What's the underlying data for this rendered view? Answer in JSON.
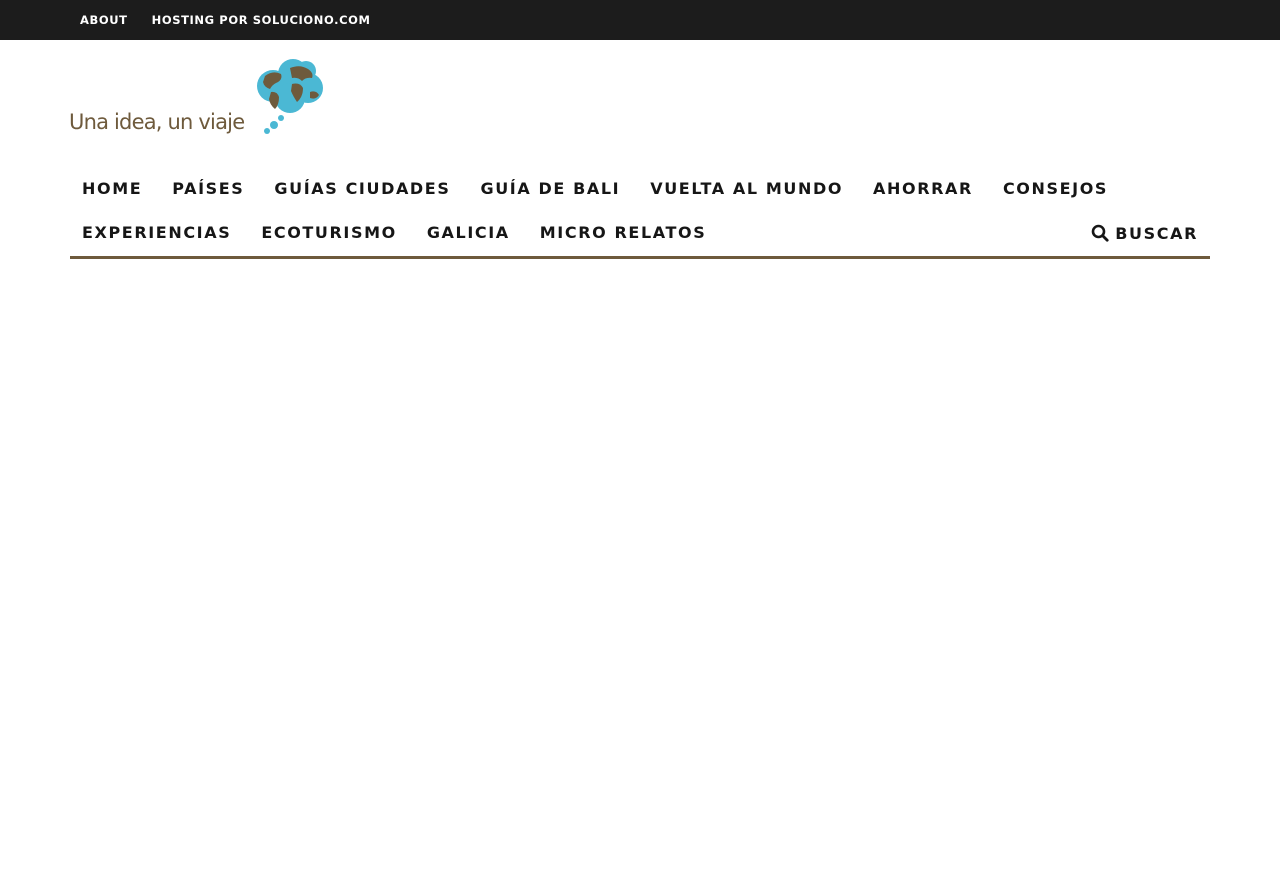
{
  "topbar": {
    "links": [
      "ABOUT",
      "HOSTING POR SOLUCIONO.COM"
    ]
  },
  "logo": {
    "text": "Una idea, un viaje",
    "colors": {
      "text": "#6e5a3c",
      "cloud": "#4bb8d4",
      "land": "#6e5a3c"
    }
  },
  "nav": {
    "row1": [
      "HOME",
      "PAÍSES",
      "GUÍAS CIUDADES",
      "GUÍA DE BALI",
      "VUELTA AL MUNDO",
      "AHORRAR",
      "CONSEJOS"
    ],
    "row2": [
      "EXPERIENCIAS",
      "ECOTURISMO",
      "GALICIA",
      "MICRO RELATOS"
    ],
    "search_label": "BUSCAR",
    "search_icon": "search-icon"
  },
  "colors": {
    "topbar_bg": "#1c1c1c",
    "accent": "#6e5a3c",
    "nav_text": "#161616"
  }
}
